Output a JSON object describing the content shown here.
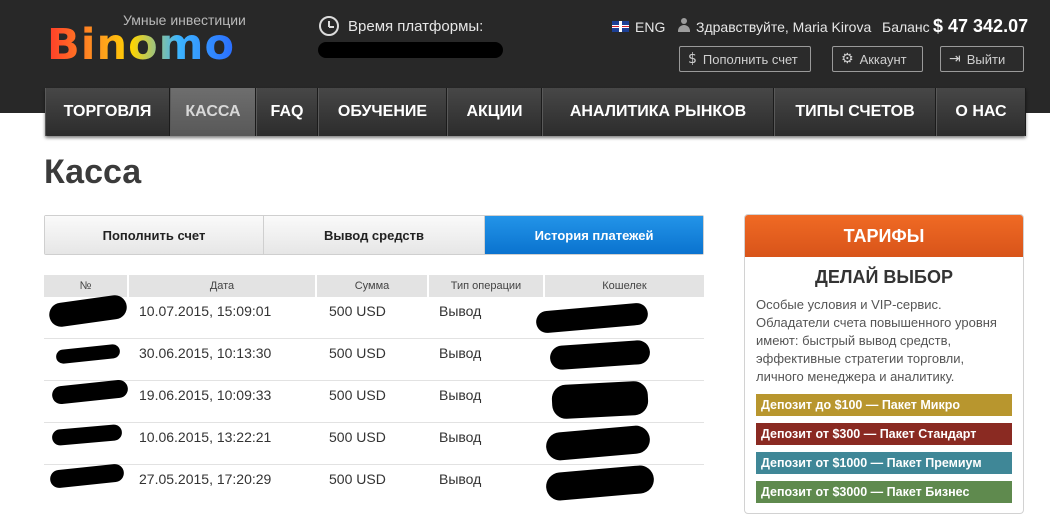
{
  "header": {
    "logo_word": "Binomo",
    "logo_tagline": "Умные инвестиции",
    "platform_time_label": "Время платформы:",
    "language": "ENG",
    "greeting": "Здравствуйте, Maria Kirova",
    "balance_label": "Баланс",
    "balance_value": "$ 47 342.07",
    "buttons": {
      "deposit": "Пополнить счет",
      "account": "Аккаунт",
      "logout": "Выйти"
    }
  },
  "nav": {
    "items": [
      {
        "label": "ТОРГОВЛЯ"
      },
      {
        "label": "КАССА"
      },
      {
        "label": "FAQ"
      },
      {
        "label": "ОБУЧЕНИЕ"
      },
      {
        "label": "АКЦИИ"
      },
      {
        "label": "АНАЛИТИКА РЫНКОВ"
      },
      {
        "label": "ТИПЫ СЧЕТОВ"
      },
      {
        "label": "О НАС"
      }
    ],
    "active_index": 1
  },
  "page_title": "Касса",
  "tabs": [
    {
      "label": "Пополнить счет"
    },
    {
      "label": "Вывод средств"
    },
    {
      "label": "История платежей"
    }
  ],
  "table": {
    "headers": [
      "№",
      "Дата",
      "Сумма",
      "Тип операции",
      "Кошелек"
    ],
    "rows": [
      {
        "date": "10.07.2015, 15:09:01",
        "amount": "500 USD",
        "type": "Вывод"
      },
      {
        "date": "30.06.2015, 10:13:30",
        "amount": "500 USD",
        "type": "Вывод"
      },
      {
        "date": "19.06.2015, 10:09:33",
        "amount": "500 USD",
        "type": "Вывод"
      },
      {
        "date": "10.06.2015, 13:22:21",
        "amount": "500 USD",
        "type": "Вывод"
      },
      {
        "date": "27.05.2015, 17:20:29",
        "amount": "500 USD",
        "type": "Вывод"
      }
    ]
  },
  "tariffs": {
    "header": "ТАРИФЫ",
    "title": "ДЕЛАЙ ВЫБОР",
    "text": "Особые условия и VIP-сервис. Обладатели счета повышенного уровня имеют: быстрый вывод средств, эффективные стратегии торговли, личного менеджера и аналитику.",
    "packages": [
      {
        "label": "Депозит до $100 — Пакет Микро",
        "color": "#b8962e"
      },
      {
        "label": "Депозит от $300 — Пакет Стандарт",
        "color": "#8a2a22"
      },
      {
        "label": "Депозит от $1000 — Пакет Премиум",
        "color": "#3f8797"
      },
      {
        "label": "Депозит от $3000 — Пакет Бизнес",
        "color": "#5f8a4e"
      }
    ]
  }
}
